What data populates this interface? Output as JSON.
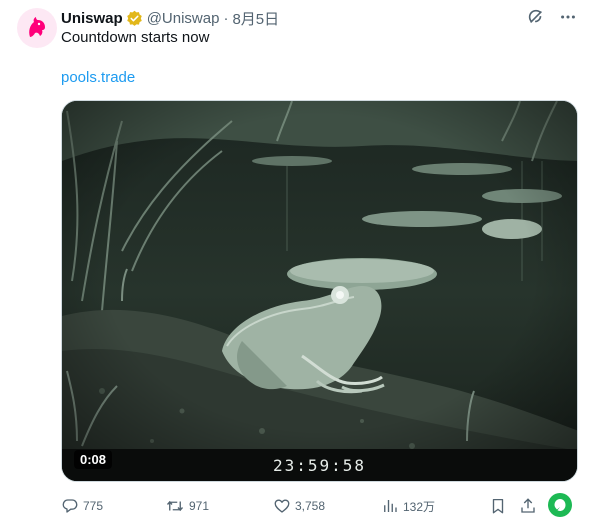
{
  "author": {
    "name": "Uniswap",
    "handle": "@Uniswap",
    "separator": "·",
    "time": "8月5日",
    "avatar_icon": "unicorn-logo-icon",
    "verified_icon": "gold-verified-badge-icon"
  },
  "header_actions": [
    "grok-icon",
    "more-icon"
  ],
  "tweet": {
    "text": "Countdown starts now",
    "link": "pools.trade"
  },
  "media": {
    "duration": "0:08",
    "countdown": "23:59:58"
  },
  "stats": {
    "replies": "775",
    "reposts": "971",
    "likes": "3,758",
    "views": "132万"
  },
  "colors": {
    "link": "#1d9bf0",
    "muted": "#536471",
    "verified_gold": "#e2b719",
    "brand_pink": "#ff007a"
  }
}
